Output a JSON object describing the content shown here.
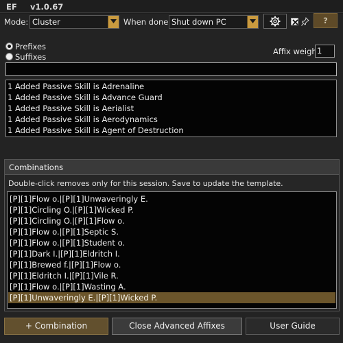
{
  "window": {
    "app_name": "EF",
    "version": "v1.0.67"
  },
  "toolbar": {
    "mode_label": "Mode:",
    "mode_value": "Cluster",
    "when_done_label": "When done:",
    "when_done_value": "Shut down PC",
    "help_label": "?"
  },
  "affix_type": {
    "prefixes_label": "Prefixes",
    "suffixes_label": "Suffixes",
    "selected": "Prefixes"
  },
  "affix_weight": {
    "label": "Affix weight",
    "value": "1"
  },
  "filter": {
    "value": ""
  },
  "affix_list": [
    "1 Added Passive Skill is Adrenaline",
    "1 Added Passive Skill is Advance Guard",
    "1 Added Passive Skill is Aerialist",
    "1 Added Passive Skill is Aerodynamics",
    "1 Added Passive Skill is Agent of Destruction"
  ],
  "combinations": {
    "title": "Combinations",
    "hint": "Double-click removes only for this session. Save to update the template.",
    "items": [
      "[P][1]Flow o.|[P][1]Unwaveringly E.",
      "[P][1]Circling O.|[P][1]Wicked P.",
      "[P][1]Circling O.|[P][1]Flow o.",
      "[P][1]Flow o.|[P][1]Septic S.",
      "[P][1]Flow o.|[P][1]Student o.",
      "[P][1]Dark I.|[P][1]Eldritch I.",
      "[P][1]Brewed f.|[P][1]Flow o.",
      "[P][1]Eldritch I.|[P][1]Vile R.",
      "[P][1]Flow o.|[P][1]Wasting A.",
      "[P][1]Unwaveringly E.|[P][1]Wicked P."
    ],
    "selected_index": 9
  },
  "buttons": {
    "add_combination": "+ Combination",
    "close_advanced": "Close Advanced Affixes",
    "user_guide": "User Guide"
  },
  "colors": {
    "accent": "#c99a3f",
    "selection": "#6b552b",
    "background": "#232323"
  },
  "icons": [
    "gear-icon",
    "close-x-icon",
    "pin-icon",
    "dropdown-arrow-icon"
  ]
}
